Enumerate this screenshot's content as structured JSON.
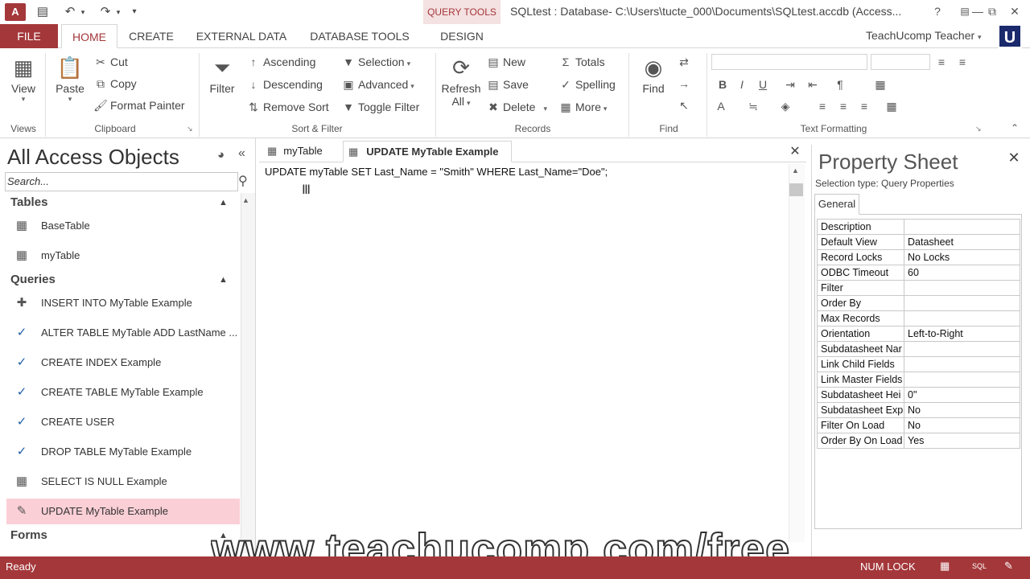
{
  "window": {
    "title": "SQLtest : Database- C:\\Users\\tucte_000\\Documents\\SQLtest.accdb (Access...",
    "context_tab": "QUERY TOOLS",
    "help": "?",
    "minimize": "—",
    "restore": "⧉",
    "close": "✕"
  },
  "quick_access": {
    "app_logo": "A",
    "save": "💾",
    "undo": "↶",
    "redo": "↷",
    "customize": "▾"
  },
  "ribbon_tabs": [
    "FILE",
    "HOME",
    "CREATE",
    "EXTERNAL DATA",
    "DATABASE TOOLS",
    "DESIGN"
  ],
  "user": {
    "name": "TeachUcomp Teacher",
    "avatar": "U"
  },
  "ribbon": {
    "views": {
      "view": "View",
      "label": "Views"
    },
    "clipboard": {
      "paste": "Paste",
      "cut": "Cut",
      "copy": "Copy",
      "format_painter": "Format Painter",
      "label": "Clipboard"
    },
    "sort_filter": {
      "filter": "Filter",
      "ascending": "Ascending",
      "descending": "Descending",
      "remove_sort": "Remove Sort",
      "selection": "Selection",
      "advanced": "Advanced",
      "toggle_filter": "Toggle Filter",
      "label": "Sort & Filter"
    },
    "records": {
      "refresh": "Refresh",
      "refresh_all": "All",
      "new": "New",
      "save": "Save",
      "delete": "Delete",
      "totals": "Totals",
      "spelling": "Spelling",
      "more": "More",
      "label": "Records"
    },
    "find": {
      "find": "Find",
      "label": "Find"
    },
    "text_formatting": {
      "label": "Text Formatting",
      "bold": "B",
      "italic": "I",
      "underline": "U",
      "font_color": "A"
    }
  },
  "nav": {
    "title": "All Access Objects",
    "search_placeholder": "Search...",
    "sections": [
      {
        "name": "Tables",
        "items": [
          "BaseTable",
          "myTable"
        ]
      },
      {
        "name": "Queries",
        "items": [
          "INSERT INTO MyTable Example",
          "ALTER TABLE MyTable ADD LastName ...",
          "CREATE INDEX Example",
          "CREATE TABLE MyTable Example",
          "CREATE USER",
          "DROP TABLE MyTable Example",
          "SELECT IS NULL Example",
          "UPDATE MyTable Example"
        ]
      },
      {
        "name": "Forms",
        "items": []
      }
    ]
  },
  "documents": {
    "tabs": [
      "myTable",
      "UPDATE MyTable Example"
    ],
    "sql": "UPDATE myTable SET Last_Name = \"Smith\" WHERE Last_Name=\"Doe\";"
  },
  "property_sheet": {
    "title": "Property Sheet",
    "selection_type": "Selection type:  Query Properties",
    "tab": "General",
    "rows": [
      [
        "Description",
        ""
      ],
      [
        "Default View",
        "Datasheet"
      ],
      [
        "Record Locks",
        "No Locks"
      ],
      [
        "ODBC Timeout",
        "60"
      ],
      [
        "Filter",
        ""
      ],
      [
        "Order By",
        ""
      ],
      [
        "Max Records",
        ""
      ],
      [
        "Orientation",
        "Left-to-Right"
      ],
      [
        "Subdatasheet Nar",
        ""
      ],
      [
        "Link Child Fields",
        ""
      ],
      [
        "Link Master Fields",
        ""
      ],
      [
        "Subdatasheet Hei",
        "0\""
      ],
      [
        "Subdatasheet Exp",
        "No"
      ],
      [
        "Filter On Load",
        "No"
      ],
      [
        "Order By On Load",
        "Yes"
      ]
    ]
  },
  "status": {
    "text": "Ready",
    "num_lock": "NUM LOCK",
    "sql_view": "SQL"
  },
  "watermark": "www.teachucomp.com/free",
  "colors": {
    "access_red": "#a4373a",
    "selection_pink": "#fbcfd6",
    "avatar_blue": "#1a2a6c"
  }
}
